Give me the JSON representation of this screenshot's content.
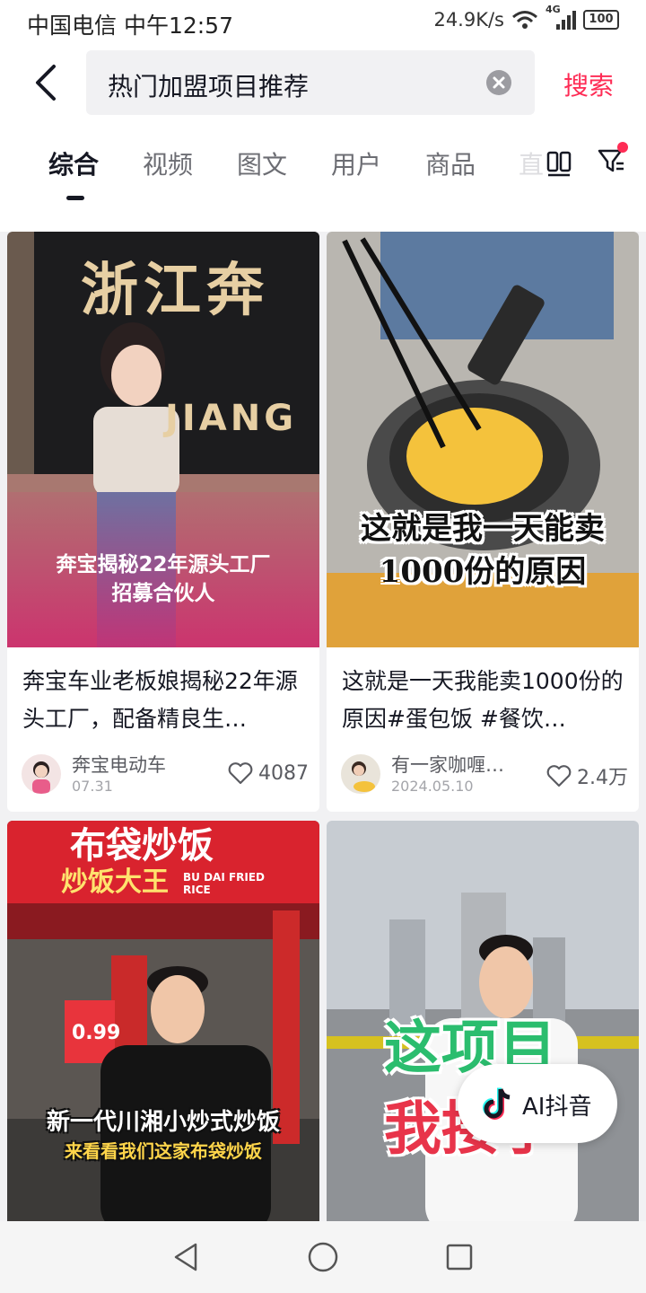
{
  "status_bar": {
    "carrier_time": "中国电信 中午12:57",
    "network_speed": "24.9K/s",
    "signal_label": "4G",
    "battery": "100"
  },
  "search": {
    "query": "热门加盟项目推荐",
    "button_label": "搜索"
  },
  "tabs": [
    {
      "label": "综合",
      "active": true
    },
    {
      "label": "视频"
    },
    {
      "label": "图文"
    },
    {
      "label": "用户"
    },
    {
      "label": "商品"
    }
  ],
  "tab_overflow_label": "直",
  "results": [
    {
      "overlay_lines": [
        "奔宝揭秘22年源头工厂",
        "招募合伙人"
      ],
      "sign_text": "浙江奔",
      "sign_sub": "JIANG",
      "title": "奔宝车业老板娘揭秘22年源头工厂，配备精良生…",
      "author": "奔宝电动车",
      "date": "07.31",
      "likes": "4087"
    },
    {
      "overlay_lines": [
        "这就是我一天能卖",
        "1000份的原因"
      ],
      "title": "这就是一天我能卖1000份的原因#蛋包饭 #餐饮…",
      "author": "有一家咖喱…",
      "date": "2024.05.10",
      "likes": "2.4万"
    },
    {
      "store_sign": "布袋炒饭",
      "store_banner": "炒饭大王",
      "store_banner_en": "BU DAI FRIED RICE",
      "price_tag": "0.99",
      "overlay_lines": [
        "新一代川湘小炒式炒饭",
        "来看看我们这家布袋炒饭"
      ]
    },
    {
      "overlay_lines": [
        "这项目",
        "我接了"
      ]
    }
  ],
  "ai_button": {
    "label": "AI抖音"
  },
  "colors": {
    "accent": "#fe2c55",
    "text_primary": "#161823",
    "text_secondary": "#5a5b61"
  }
}
